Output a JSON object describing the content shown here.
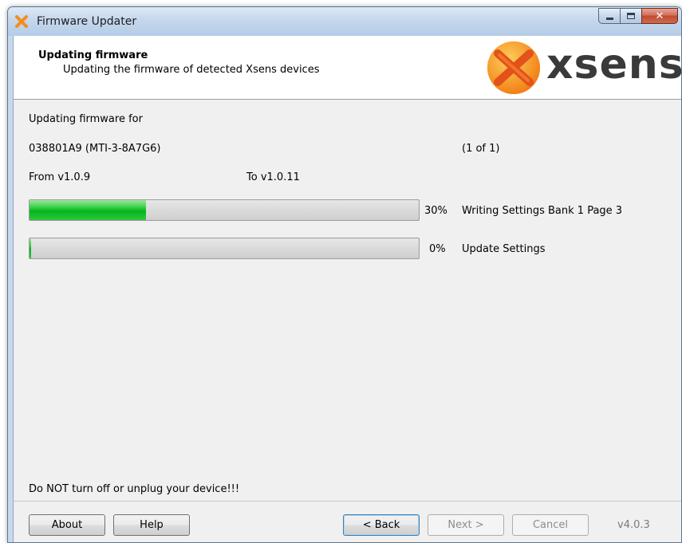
{
  "window": {
    "title": "Firmware Updater",
    "controls": {
      "minimize": "minimize",
      "maximize": "maximize",
      "close": "close"
    }
  },
  "header": {
    "title": "Updating firmware",
    "subtitle": "Updating the firmware of detected Xsens devices",
    "logo_text": "xsens"
  },
  "content": {
    "updating_for_label": "Updating firmware for",
    "device_id": "038801A9 (MTI-3-8A7G6)",
    "device_count": "(1 of 1)",
    "from_version": "From v1.0.9",
    "to_version": "To v1.0.11",
    "progress": [
      {
        "percent_label": "30%",
        "value": 0.3,
        "status": "Writing Settings Bank 1 Page 3"
      },
      {
        "percent_label": "0%",
        "value": 0.0,
        "status": "Update Settings"
      }
    ],
    "warning": "Do NOT turn off or unplug your device!!!"
  },
  "footer": {
    "about_label": "About",
    "help_label": "Help",
    "back_label": "< Back",
    "next_label": "Next >",
    "cancel_label": "Cancel",
    "version": "v4.0.3"
  },
  "colors": {
    "progress_fill": "#06b41f",
    "logo_orange": "#f28e1c",
    "logo_text": "#3a3a3a"
  }
}
